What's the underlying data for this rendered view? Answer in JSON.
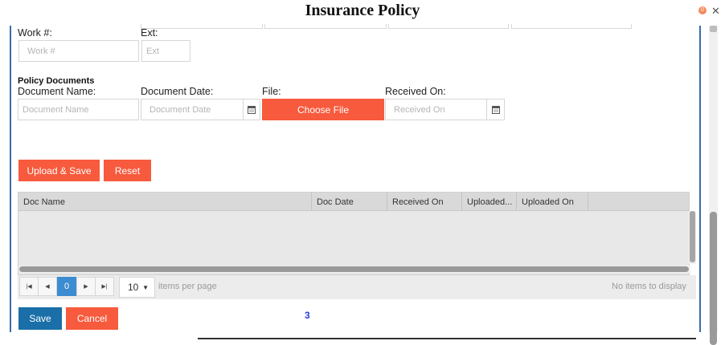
{
  "dialog": {
    "title": "Insurance Policy",
    "badge_text": "0"
  },
  "contact": {
    "work_label": "Work #:",
    "work_placeholder": "Work #",
    "ext_label": "Ext:",
    "ext_placeholder": "Ext"
  },
  "policy_documents": {
    "section_title": "Policy Documents",
    "document_name_label": "Document Name:",
    "document_name_placeholder": "Document Name",
    "document_date_label": "Document Date:",
    "document_date_placeholder": "Document Date",
    "file_label": "File:",
    "choose_file_label": "Choose File",
    "received_on_label": "Received On:",
    "received_on_placeholder": "Received On",
    "upload_save_label": "Upload & Save",
    "reset_label": "Reset"
  },
  "grid": {
    "columns": [
      "Doc Name",
      "Doc Date",
      "Received On",
      "Uploaded...",
      "Uploaded On"
    ]
  },
  "pager": {
    "first_icon": "first-page-icon",
    "prev_icon": "prev-page-icon",
    "current_page": "0",
    "next_icon": "next-page-icon",
    "last_icon": "last-page-icon",
    "page_size": "10",
    "items_per_page_label": "items per page",
    "no_items_text": "No items to display"
  },
  "footer": {
    "save_label": "Save",
    "cancel_label": "Cancel",
    "page_counter": "3"
  },
  "colors": {
    "accent_red": "#f75a3d",
    "accent_blue": "#1a6fa8",
    "pager_active": "#3d8bd1"
  }
}
